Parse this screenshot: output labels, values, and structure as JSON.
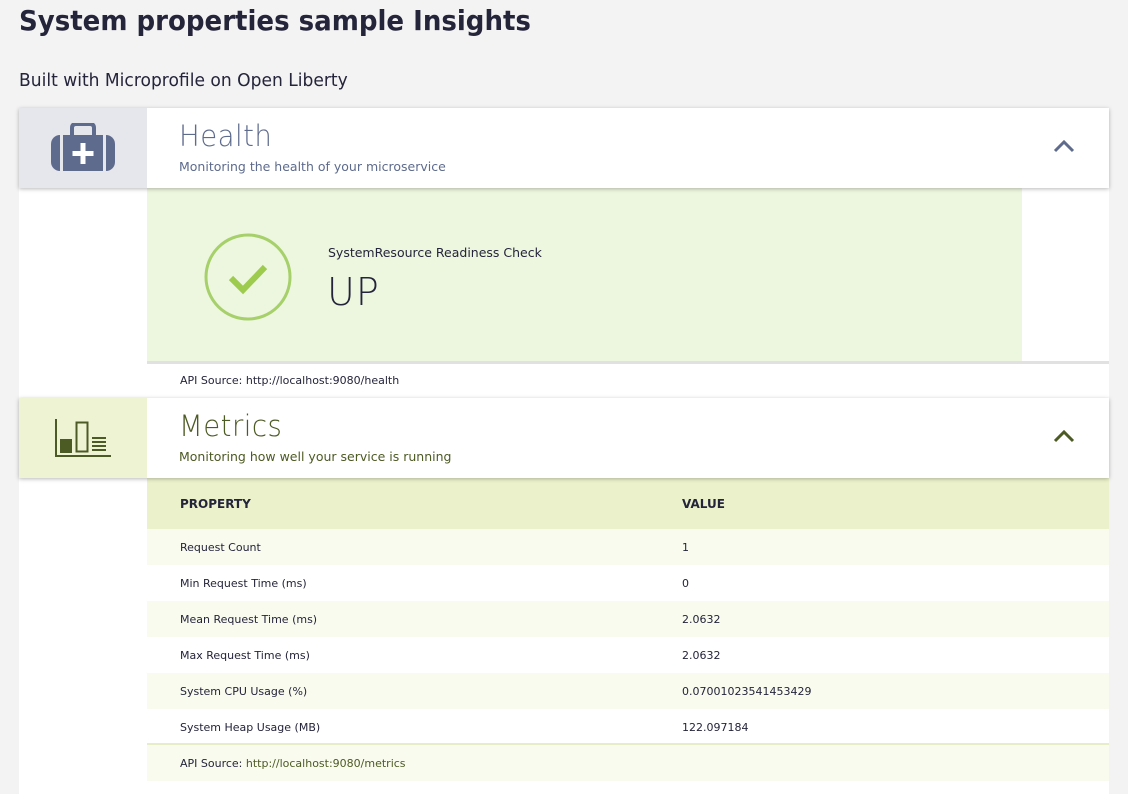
{
  "page": {
    "title": "System properties sample Insights",
    "subtitle": "Built with Microprofile on Open Liberty"
  },
  "health": {
    "title": "Health",
    "description": "Monitoring the health of your microservice",
    "check_name": "SystemResource Readiness Check",
    "check_status": "UP",
    "api_label": "API Source: ",
    "api_url": "http://localhost:9080/health",
    "icon": "first-aid-kit-icon",
    "accent": "#9ccb4d"
  },
  "metrics": {
    "title": "Metrics",
    "description": "Monitoring how well your service is running",
    "columns": [
      "PROPERTY",
      "VALUE"
    ],
    "rows": [
      {
        "property": "Request Count",
        "value": "1"
      },
      {
        "property": "Min Request Time (ms)",
        "value": "0"
      },
      {
        "property": "Mean Request Time (ms)",
        "value": "2.0632"
      },
      {
        "property": "Max Request Time (ms)",
        "value": "2.0632"
      },
      {
        "property": "System CPU Usage (%)",
        "value": "0.07001023541453429"
      },
      {
        "property": "System Heap Usage (MB)",
        "value": "122.097184"
      }
    ],
    "api_label": "API Source: ",
    "api_url": "http://localhost:9080/metrics",
    "icon": "bar-chart-icon",
    "accent": "#4c5a24"
  }
}
